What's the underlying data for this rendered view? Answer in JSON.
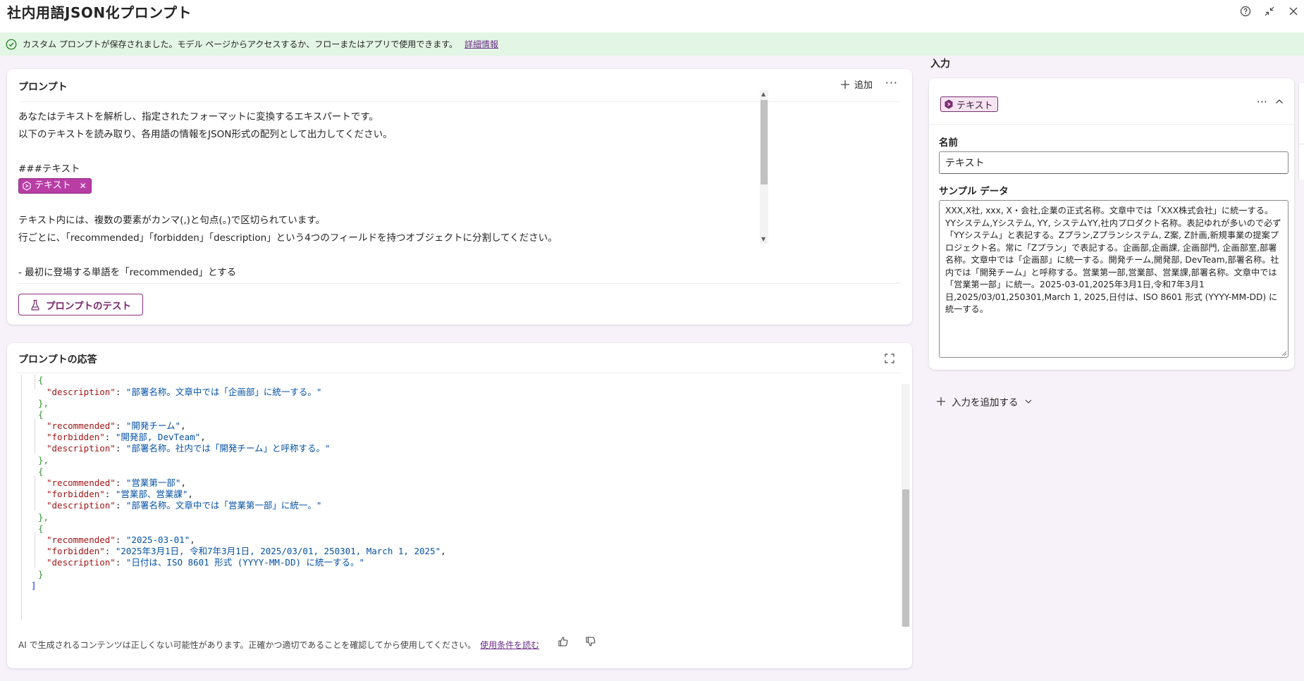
{
  "header": {
    "title": "社内用語JSON化プロンプト",
    "icons": [
      "help-icon",
      "collapse-icon",
      "close-icon"
    ]
  },
  "banner": {
    "message": "カスタム プロンプトが保存されました。モデル ページからアクセスするか、フローまたはアプリで使用できます。",
    "link": "詳細情報"
  },
  "prompt": {
    "title": "プロンプト",
    "add_label": "追加",
    "lines": [
      "あなたはテキストを解析し、指定されたフォーマットに変換するエキスパートです。",
      "以下のテキストを読み取り、各用語の情報をJSON形式の配列として出力してください。",
      "",
      "###テキスト",
      "",
      "",
      "テキスト内には、複数の要素がカンマ(,)と句点(。)で区切られています。",
      "行ごとに、「recommended」「forbidden」「description」という4つのフィールドを持つオブジェクトに分割してください。",
      "",
      "- 最初に登場する単語を「recommended」とする"
    ],
    "chip_label": "テキスト",
    "test_button": "プロンプトのテスト"
  },
  "response": {
    "title": "プロンプトの応答",
    "objects": [
      {
        "description": "\"部署名称。文章中では「企画部」に統一する。\""
      },
      {
        "recommended": "\"開発チーム\"",
        "forbidden": "\"開発部, DevTeam\"",
        "description": "\"部署名称。社内では「開発チーム」と呼称する。\""
      },
      {
        "recommended": "\"営業第一部\"",
        "forbidden": "\"営業部、営業課\"",
        "description": "\"部署名称。文章中では「営業第一部」に統一。\""
      },
      {
        "recommended": "\"2025-03-01\"",
        "forbidden": "\"2025年3月1日, 令和7年3月1日, 2025/03/01, 250301, March 1, 2025\"",
        "description": "\"日付は、ISO 8601 形式 (YYYY-MM-DD) に統一する。\""
      }
    ],
    "keys": {
      "recommended": "\"recommended\"",
      "forbidden": "\"forbidden\"",
      "description": "\"description\""
    },
    "disclaimer": "AI で生成されるコンテンツは正しくない可能性があります。正確かつ適切であることを確認してから使用してください。",
    "terms_link": "使用条件を読む"
  },
  "input_panel": {
    "heading": "入力",
    "chip_label": "テキスト",
    "name_label": "名前",
    "name_value": "テキスト",
    "sample_label": "サンプル データ",
    "sample_value": "XXX,X社, xxx, X・会社,企業の正式名称。文章中では「XXX株式会社」に統一する。YYシステム,Yシステム, YY, システムYY,社内プロダクト名称。表記ゆれが多いので必ず「YYシステム」と表記する。Zプラン,Zプランシステム, Z案, Z計画,新規事業の提案プロジェクト名。常に「Zプラン」で表記する。企画部,企画課, 企画部門, 企画部室,部署名称。文章中では「企画部」に統一する。開発チーム,開発部, DevTeam,部署名称。社内では「開発チーム」と呼称する。営業第一部,営業部、営業課,部署名称。文章中では「営業第一部」に統一。2025-03-01,2025年3月1日,令和7年3月1日,2025/03/01,250301,March 1, 2025,日付は、ISO 8601 形式 (YYYY-MM-DD) に統一する。",
    "add_input_label": "入力を追加する"
  },
  "colors": {
    "accent": "#8b2e7e",
    "banner_bg": "#e3f5e4",
    "success": "#107c10"
  }
}
